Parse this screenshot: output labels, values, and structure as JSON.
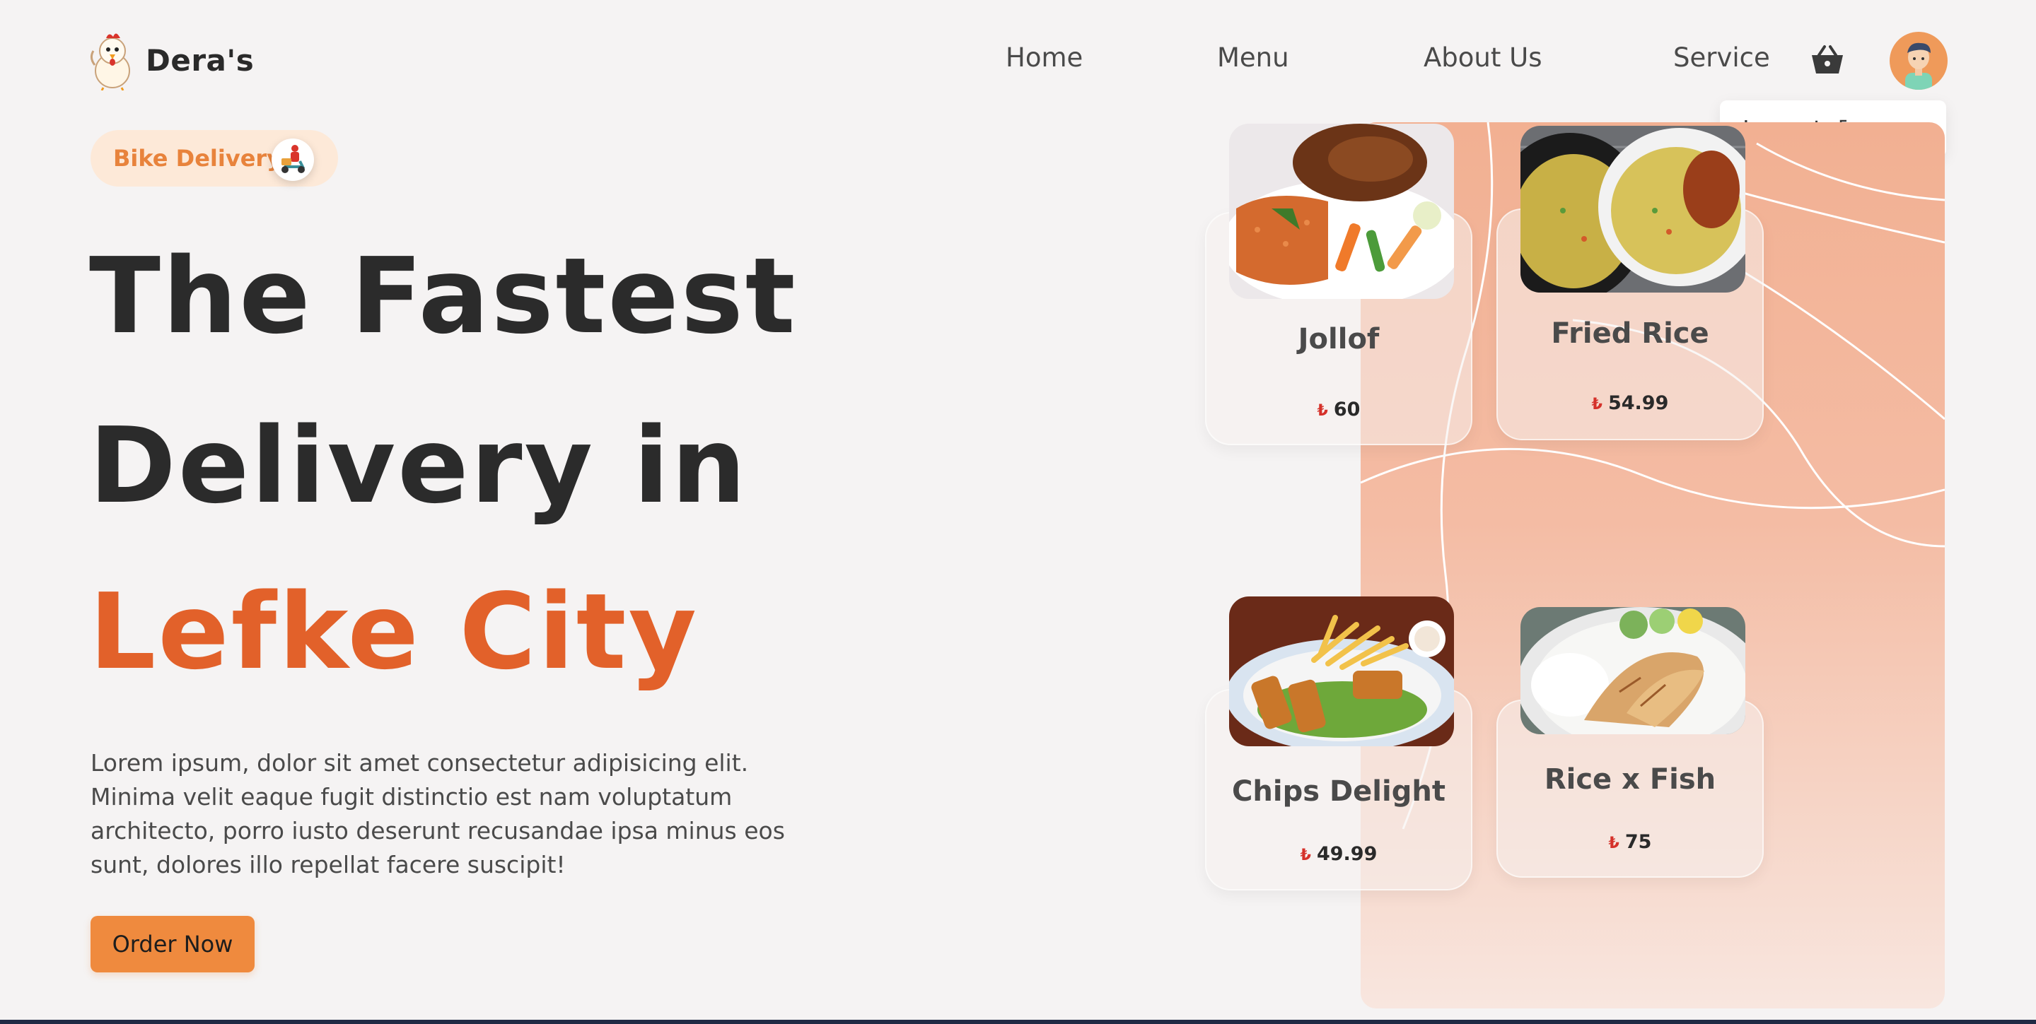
{
  "brand": {
    "name": "Dera's"
  },
  "nav": {
    "home": "Home",
    "menu": "Menu",
    "about": "About Us",
    "service": "Service"
  },
  "user_menu": {
    "logout": "Logout"
  },
  "hero": {
    "badge": "Bike Delivery",
    "line1": "The Fastest",
    "line2": "Delivery in",
    "line3": "Lefke City",
    "description": "Lorem ipsum, dolor sit amet consectetur adipisicing elit. Minima velit eaque fugit distinctio est nam voluptatum architecto, porro iusto deserunt recusandae ipsa minus eos sunt, dolores illo repellat facere suscipit!",
    "cta": "Order Now"
  },
  "currency_symbol": "₺",
  "foods": [
    {
      "name": "Jollof",
      "price": "60"
    },
    {
      "name": "Fried Rice",
      "price": "54.99"
    },
    {
      "name": "Chips Delight",
      "price": "49.99"
    },
    {
      "name": "Rice x Fish",
      "price": "75"
    }
  ],
  "colors": {
    "accent": "#e2612a",
    "button": "#ef8a3e",
    "badge_bg": "#fde9d8",
    "panel": "#f2b092"
  },
  "icons": [
    "chicken-logo-icon",
    "basket-icon",
    "user-avatar-icon",
    "logout-icon",
    "scooter-icon"
  ]
}
